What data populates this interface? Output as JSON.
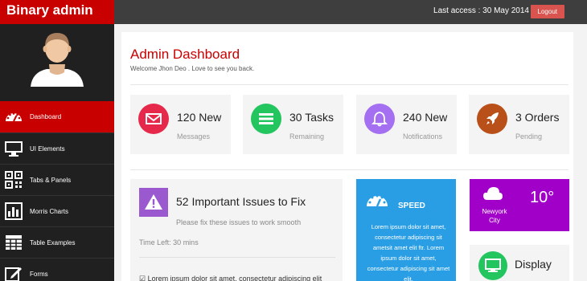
{
  "app": {
    "brand": "Binary admin"
  },
  "header": {
    "last_access": "Last access : 30 May 2014",
    "logout_label": "Logout"
  },
  "sidebar": {
    "items": [
      {
        "label": "Dashboard",
        "icon": "dashboard-icon",
        "active": true
      },
      {
        "label": "UI Elements",
        "icon": "desktop-icon"
      },
      {
        "label": "Tabs & Panels",
        "icon": "qrcode-icon"
      },
      {
        "label": "Morris Charts",
        "icon": "bar-chart-icon"
      },
      {
        "label": "Table Examples",
        "icon": "table-icon"
      },
      {
        "label": "Forms",
        "icon": "edit-icon"
      }
    ]
  },
  "page": {
    "title": "Admin Dashboard",
    "subtitle": "Welcome Jhon Deo . Love to see you back."
  },
  "stats": [
    {
      "value": "120 New",
      "label": "Messages",
      "color": "#e6284a",
      "icon": "envelope-icon"
    },
    {
      "value": "30 Tasks",
      "label": "Remaining",
      "color": "#22c55e",
      "icon": "list-icon"
    },
    {
      "value": "240 New",
      "label": "Notifications",
      "color": "#a46ff0",
      "icon": "bell-icon"
    },
    {
      "value": "3 Orders",
      "label": "Pending",
      "color": "#b94f19",
      "icon": "rocket-icon"
    }
  ],
  "issues": {
    "title": "52 Important Issues to Fix",
    "note": "Please fix these issues to work smooth",
    "time_left": "Time Left: 30 mins",
    "first_task": "Lorem ipsum dolor sit amet, consectetur adipiscing elit"
  },
  "speed": {
    "title": "SPEED",
    "text": "Lorem ipsum dolor sit amet, consectetur adipiscing sit ametsit amet elit ftr. Lorem ipsum dolor sit amet, consectetur adipiscing sit amet elit."
  },
  "weather": {
    "temperature": "10°",
    "city": "Newyork City"
  },
  "display": {
    "label": "Display"
  },
  "colors": {
    "brand": "#c90000",
    "topbar": "#3e3e3e",
    "sidebar": "#202020",
    "speed": "#2a9ee5",
    "weather": "#a000c8"
  }
}
